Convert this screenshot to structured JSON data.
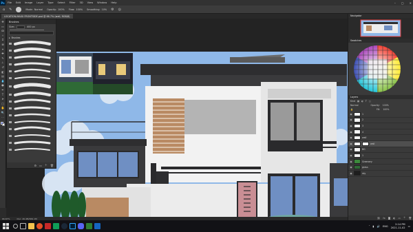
{
  "menubar": {
    "logo": "Ps",
    "items": [
      "File",
      "Edit",
      "Image",
      "Layer",
      "Type",
      "Select",
      "Filter",
      "3D",
      "View",
      "Window",
      "Help"
    ],
    "controls": [
      "–",
      "▢",
      "✕"
    ]
  },
  "options": {
    "mode_label": "Mode:",
    "mode_value": "Normal",
    "opacity_label": "Opacity:",
    "opacity_value": "100%",
    "flow_label": "Flow:",
    "flow_value": "100%",
    "smoothing_label": "Smoothing:",
    "smoothing_value": "10%"
  },
  "document_tab": "LOCATION-MAXX FRONTSIDE.psd @ 66.7% (wall, RGB/8)",
  "brushes_panel": {
    "title": "Brushes",
    "size_label": "Size:",
    "size_value": "400 px",
    "group_label": "Brushes"
  },
  "navigator": {
    "title": "Navigator"
  },
  "swatches": {
    "title": "Swatches"
  },
  "layers": {
    "title": "Layers",
    "kind_label": "Kind",
    "blend_mode": "Normal",
    "opacity_label": "Opacity:",
    "opacity_value": "100%",
    "fill_label": "Fill:",
    "fill_value": "100%",
    "rows": [
      {
        "name": "1"
      },
      {
        "name": "2"
      },
      {
        "name": "3"
      },
      {
        "name": "4"
      },
      {
        "name": "wall"
      },
      {
        "name": "wall"
      },
      {
        "name": "BG"
      },
      {
        "name": "1"
      },
      {
        "name": "Greenery"
      },
      {
        "name": "grass"
      },
      {
        "name": "sky"
      }
    ],
    "active_index": 5
  },
  "status": {
    "zoom": "66.67%",
    "doc": "Doc: 26.4M/369.1M"
  },
  "taskbar": {
    "lang": "ENG",
    "time": "2:14 PM",
    "date": "2021-11-02"
  },
  "colors": {
    "sky": "#8fb8e8",
    "wall_white": "#f2f2f2",
    "wall_gray": "#bdbdbd",
    "roof_dark": "#2e2e30",
    "window_blue": "#6f8fc3",
    "wood": "#b98a63",
    "door_pink": "#c98e94",
    "tree": "#1f5a2a"
  }
}
